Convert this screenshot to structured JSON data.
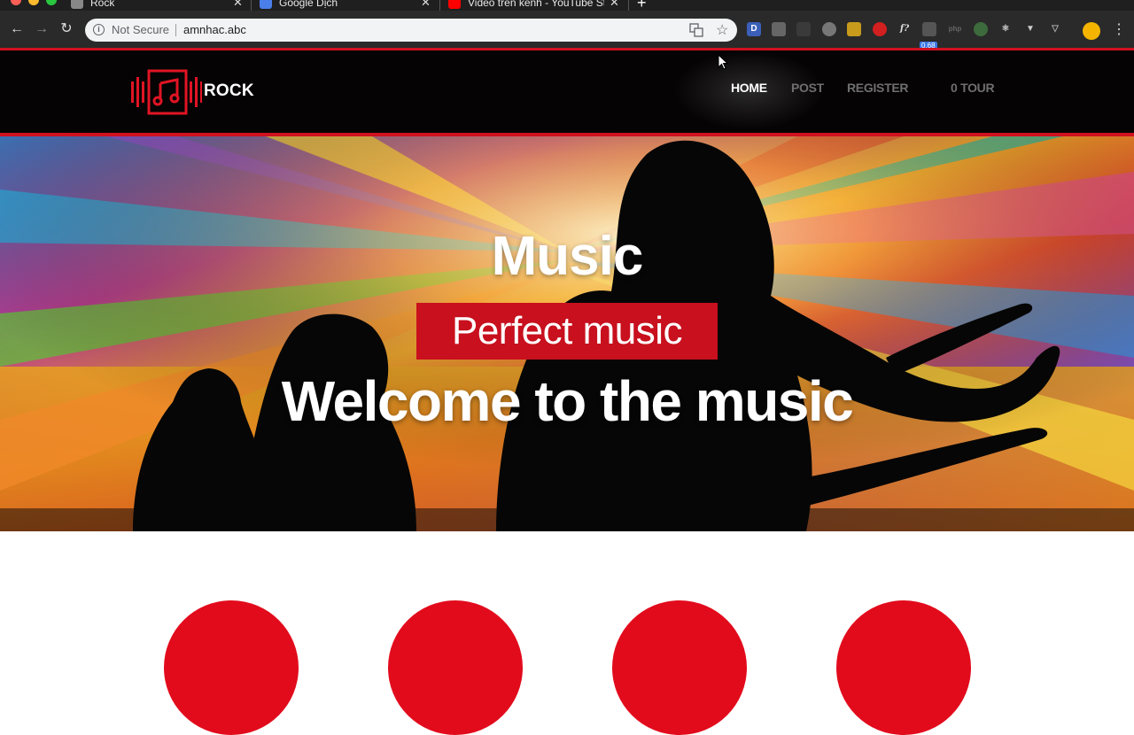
{
  "browser": {
    "tabs": [
      {
        "title": "Rock"
      },
      {
        "title": "Google Dịch"
      },
      {
        "title": "Video trên kênh - YouTube Stu"
      }
    ],
    "address_bar": {
      "security_label": "Not Secure",
      "url": "amnhac.abc"
    },
    "extension_badge": "0.68"
  },
  "site": {
    "logo_text": "ROCK",
    "nav": [
      {
        "label": "HOME",
        "active": true
      },
      {
        "label": "POST",
        "active": false
      },
      {
        "label": "REGISTER",
        "active": false
      },
      {
        "label": "0 TOUR",
        "active": false
      }
    ],
    "hero": {
      "title": "Music",
      "tagline": "Perfect music",
      "welcome": "Welcome to the music"
    }
  },
  "colors": {
    "accent_red": "#d0111f",
    "header_bg": "#050303",
    "circle_red": "#e20b1c"
  }
}
